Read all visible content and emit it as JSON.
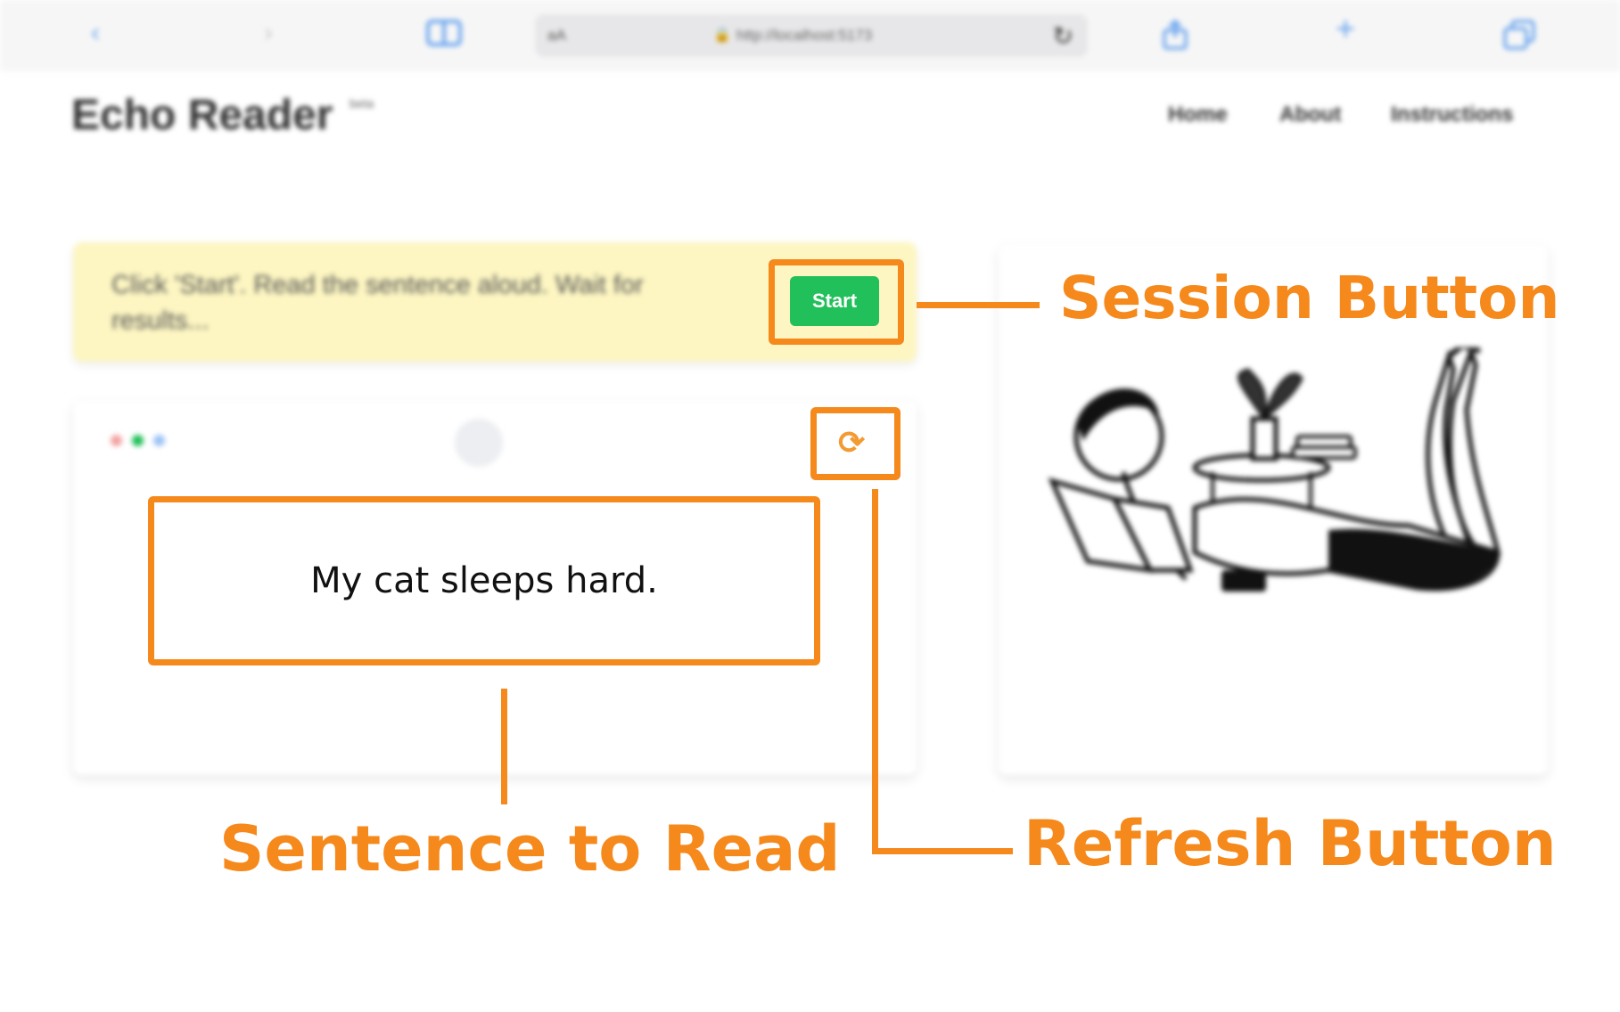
{
  "browser": {
    "url_prefix": "aA",
    "url": "http://localhost:5173",
    "icons": [
      "back-icon",
      "forward-icon",
      "reader-icon",
      "lock-icon",
      "reload-icon",
      "share-icon",
      "plus-icon",
      "tabs-icon"
    ]
  },
  "app": {
    "brand": "Echo Reader",
    "brand_tag": "beta",
    "nav": [
      "Home",
      "About",
      "Instructions"
    ]
  },
  "banner": {
    "instruction": "Click 'Start'. Read the sentence aloud. Wait for results...",
    "start_label": "Start"
  },
  "reader": {
    "sentence": "My cat sleeps hard.",
    "refresh_icon": "refresh-icon"
  },
  "callouts": {
    "session_button": "Session  Button",
    "sentence_to_read": "Sentence to Read",
    "refresh_button": "Refresh Button"
  },
  "colors": {
    "annotation": "#f5891c",
    "start_button": "#22c05a",
    "banner_bg": "#fdf6c2",
    "refresh_icon": "#f39a32"
  }
}
